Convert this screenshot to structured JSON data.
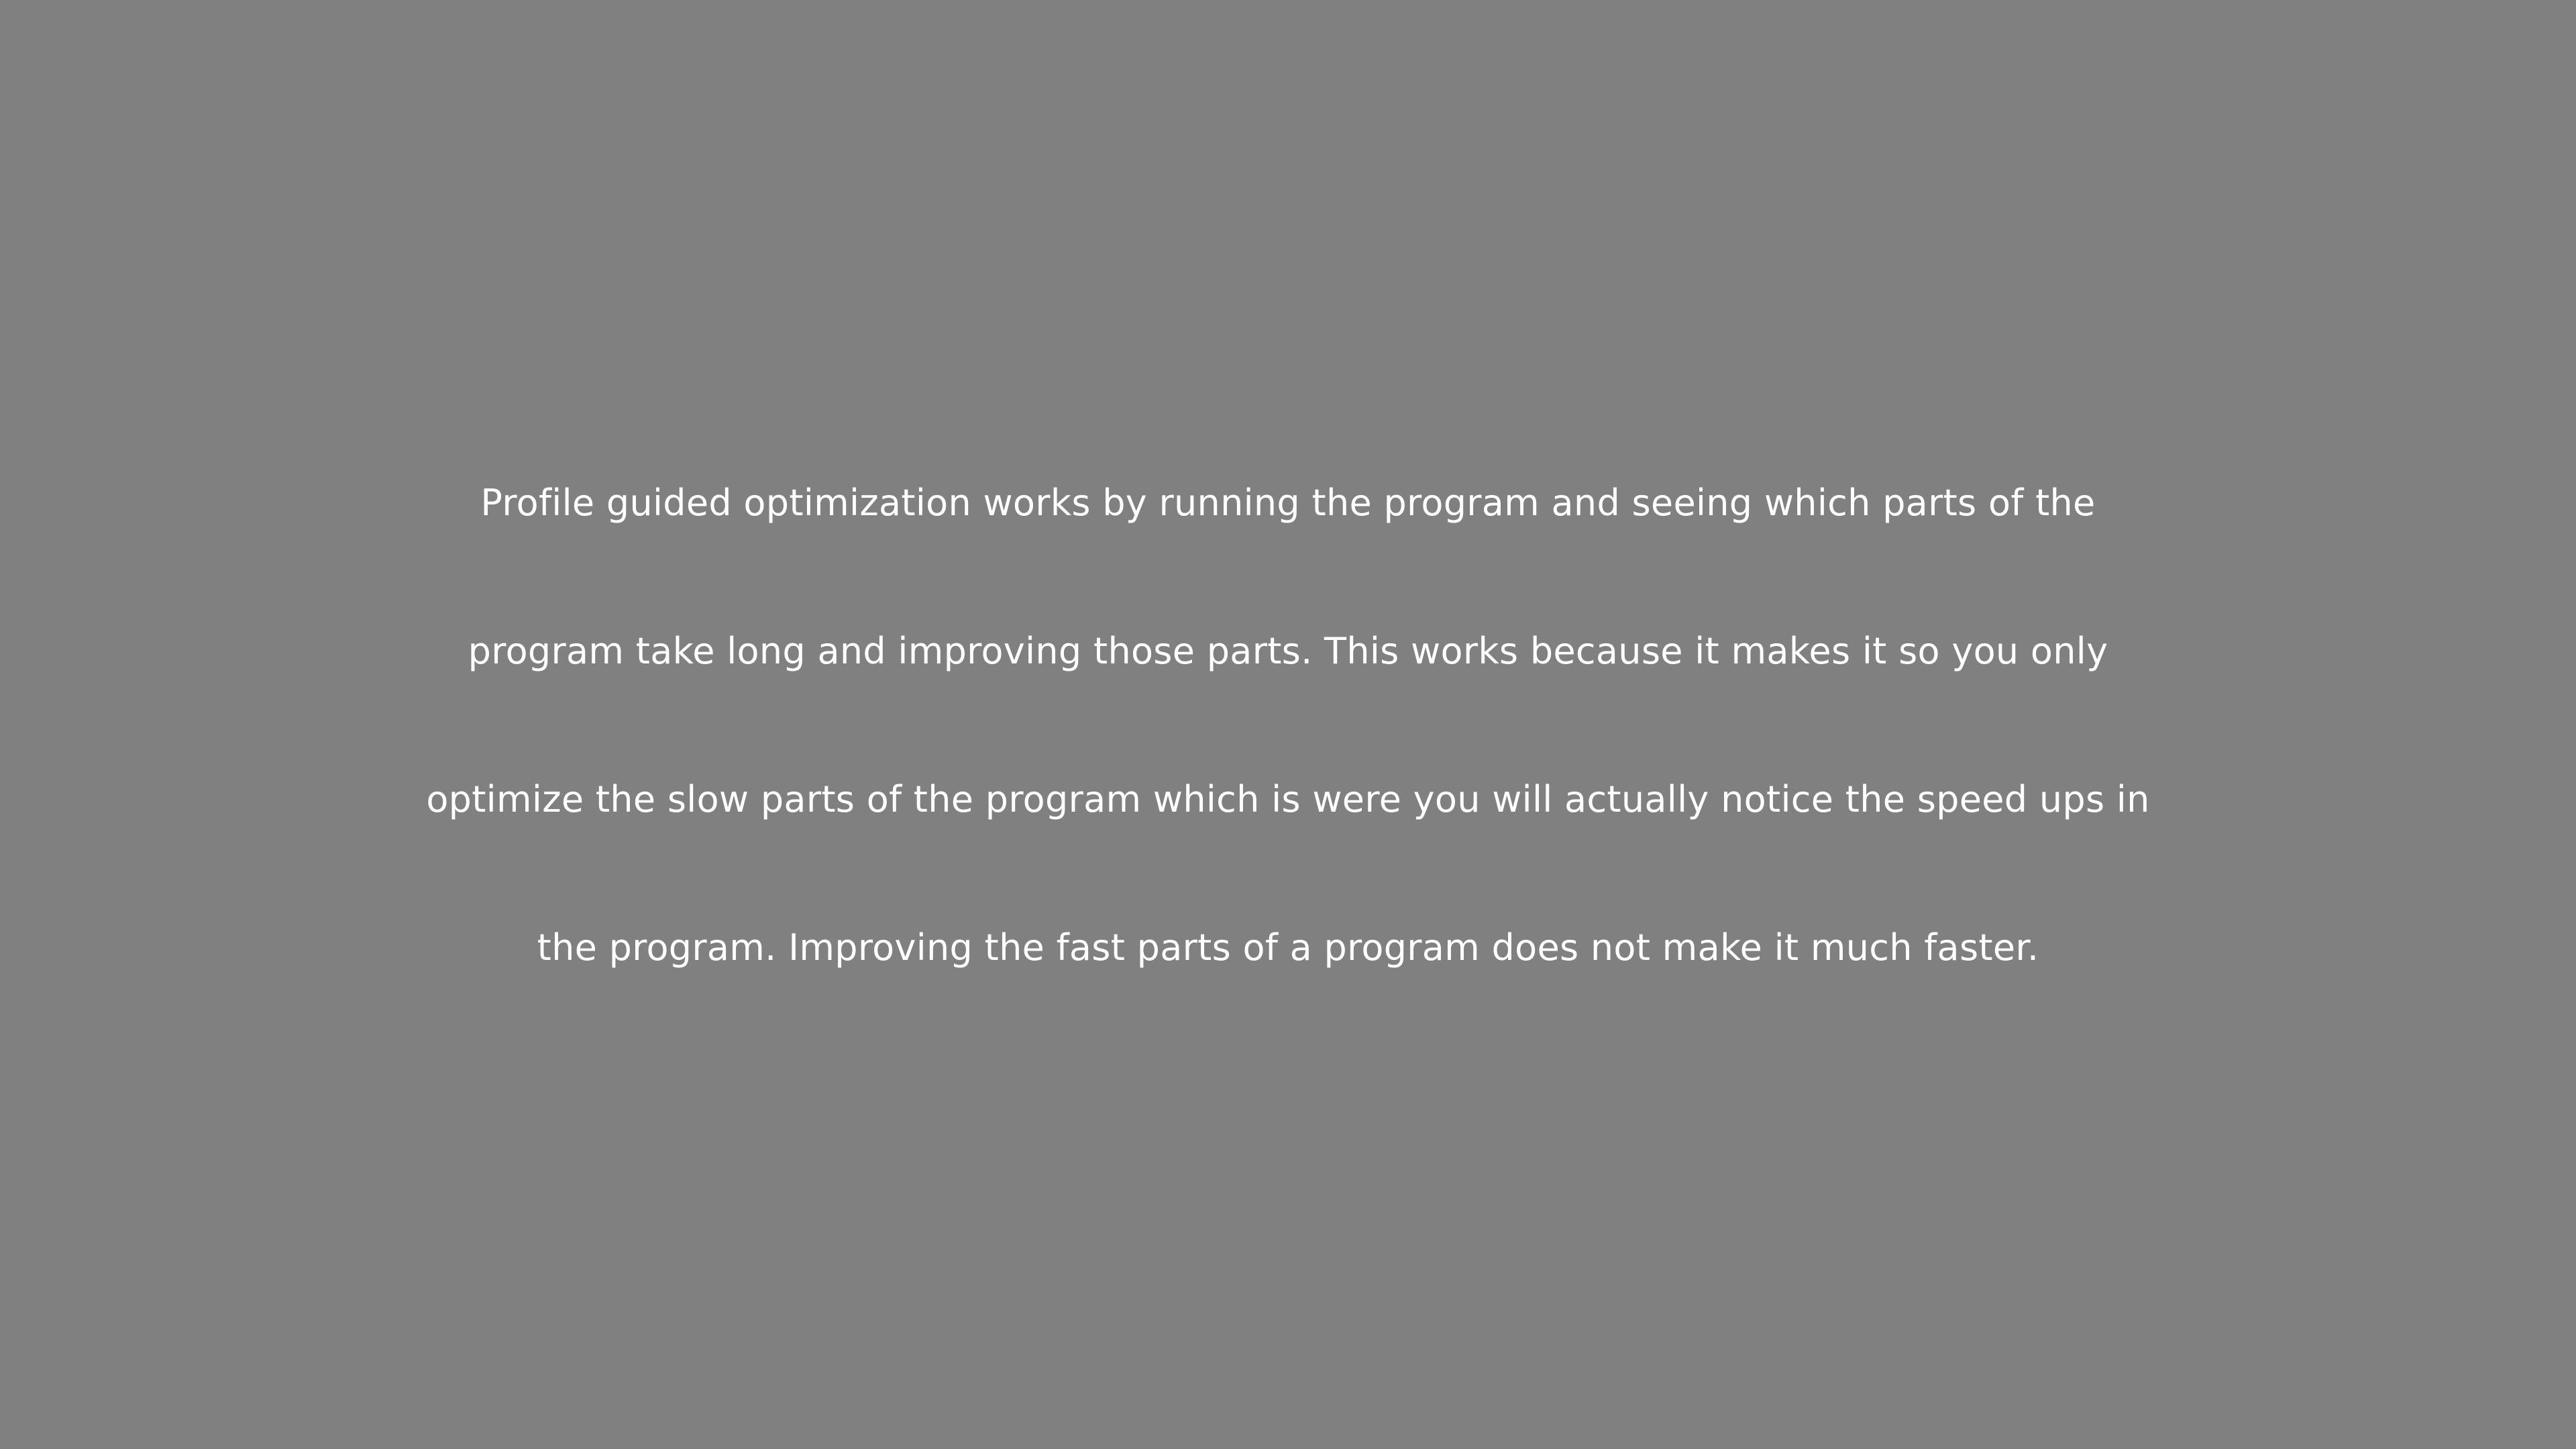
{
  "background_color": "#808080",
  "text_color": "#ffffff",
  "paragraph": {
    "lines": [
      "Profile guided optimization works by running the program and seeing which parts of the",
      "program take long and improving those parts. This works because it makes it so you only",
      "optimize the slow parts of the program which is were you will actually notice the speed ups in",
      "the program. Improving the fast parts of a program does not make it much faster."
    ]
  }
}
